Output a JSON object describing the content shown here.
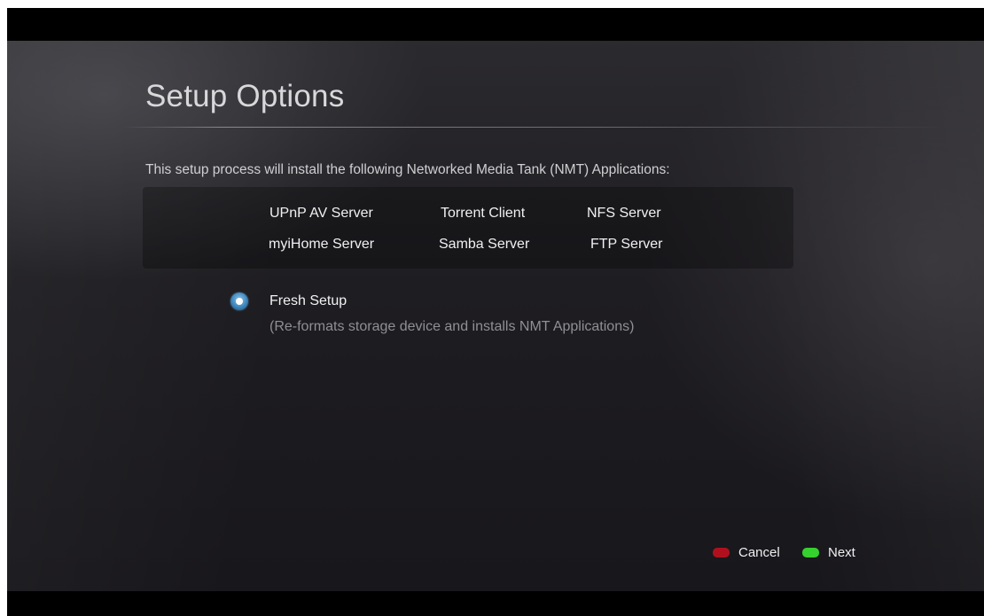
{
  "page": {
    "title": "Setup Options",
    "intro": "This setup process will install the following Networked Media Tank (NMT) Applications:"
  },
  "applications": [
    [
      "UPnP AV Server",
      "Torrent Client",
      "NFS Server"
    ],
    [
      "myiHome Server",
      "Samba Server",
      "FTP Server"
    ]
  ],
  "option": {
    "label": "Fresh Setup",
    "description": "(Re-formats storage device and installs NMT Applications)",
    "selected": true
  },
  "footer": {
    "cancel_label": "Cancel",
    "cancel_color": "#b0101e",
    "next_label": "Next",
    "next_color": "#35d12e"
  }
}
